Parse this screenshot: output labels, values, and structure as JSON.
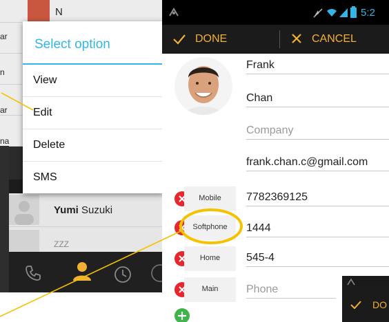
{
  "contacts_list": {
    "top_row_name": "N",
    "edge_fragments": [
      "ar",
      "n",
      "ar",
      "na"
    ],
    "visible_contact": {
      "first": "Yumi",
      "last": "Suzuki"
    },
    "partial_contact": "ZZZ"
  },
  "dialog": {
    "title": "Select option",
    "options": [
      "View",
      "Edit",
      "Delete",
      "SMS"
    ]
  },
  "status_bar": {
    "time": "5:2"
  },
  "action_bar": {
    "done_label": "DONE",
    "cancel_label": "CANCEL"
  },
  "mini_action_bar": {
    "done_label": "DO"
  },
  "contact_form": {
    "first_name": "Frank",
    "last_name": "Chan",
    "company_placeholder": "Company",
    "email": "frank.chan.c@gmail.com",
    "phones": [
      {
        "type": "Mobile",
        "number": "7782369125",
        "placeholder": ""
      },
      {
        "type": "Softphone",
        "number": "1444",
        "placeholder": ""
      },
      {
        "type": "Home",
        "number": "545-4",
        "placeholder": ""
      },
      {
        "type": "Main",
        "number": "",
        "placeholder": "Phone"
      }
    ]
  },
  "colors": {
    "accent_blue": "#33b5e5",
    "action_orange": "#f2b134",
    "delete_red": "#e8262e",
    "add_green": "#3fb549",
    "highlight_yellow": "#f5c200"
  }
}
